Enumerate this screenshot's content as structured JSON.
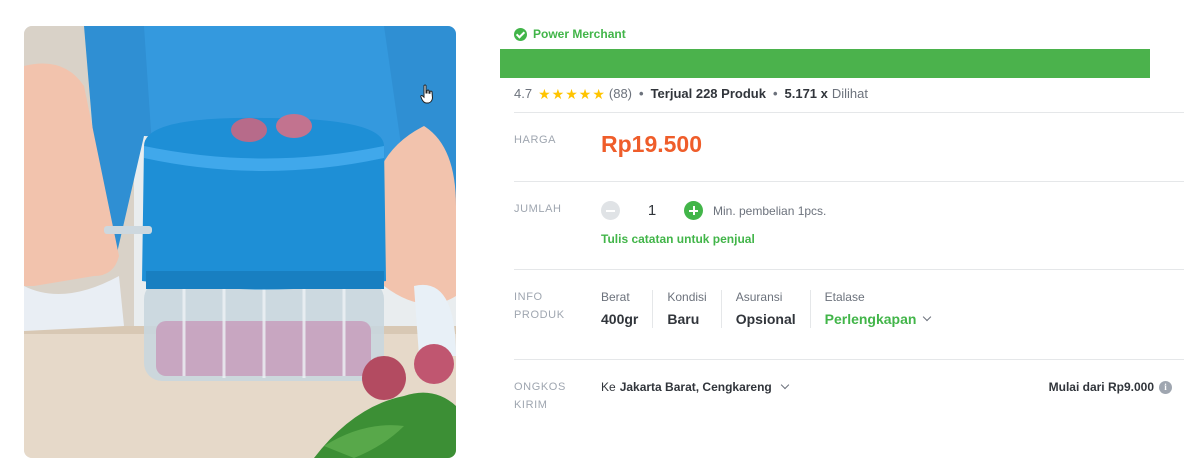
{
  "badge": {
    "label": "Power Merchant"
  },
  "title": "",
  "stats": {
    "rating": "4.7",
    "stars": 5,
    "review_count": "(88)",
    "sold": "Terjual 228 Produk",
    "views_count": "5.171 x",
    "views_suffix": "Dilihat"
  },
  "price": {
    "label": "HARGA",
    "value": "Rp19.500"
  },
  "quantity": {
    "label": "JUMLAH",
    "value": "1",
    "min_note": "Min. pembelian 1pcs.",
    "notes_link": "Tulis catatan untuk penjual"
  },
  "product_info": {
    "label_line1": "INFO",
    "label_line2": "PRODUK",
    "specs": [
      {
        "label": "Berat",
        "value": "400gr"
      },
      {
        "label": "Kondisi",
        "value": "Baru"
      },
      {
        "label": "Asuransi",
        "value": "Opsional"
      },
      {
        "label": "Etalase",
        "value": "Perlengkapan"
      }
    ]
  },
  "shipping": {
    "label_line1": "ONGKOS",
    "label_line2": "KIRIM",
    "prefix": "Ke",
    "destination": "Jakarta Barat, Cengkareng",
    "price": "Mulai dari Rp9.000",
    "info_icon": "i"
  },
  "colors": {
    "green": "#42b549",
    "price": "#ef5d2a",
    "star": "#ffc400",
    "title_bar": "#4bb24c"
  },
  "icons": {
    "badge": "check-badge-icon",
    "star": "star-icon",
    "minus": "minus-circle-icon",
    "plus": "plus-circle-icon",
    "chevron": "chevron-down-icon",
    "info": "info-icon",
    "cursor": "hand-cursor-icon"
  }
}
